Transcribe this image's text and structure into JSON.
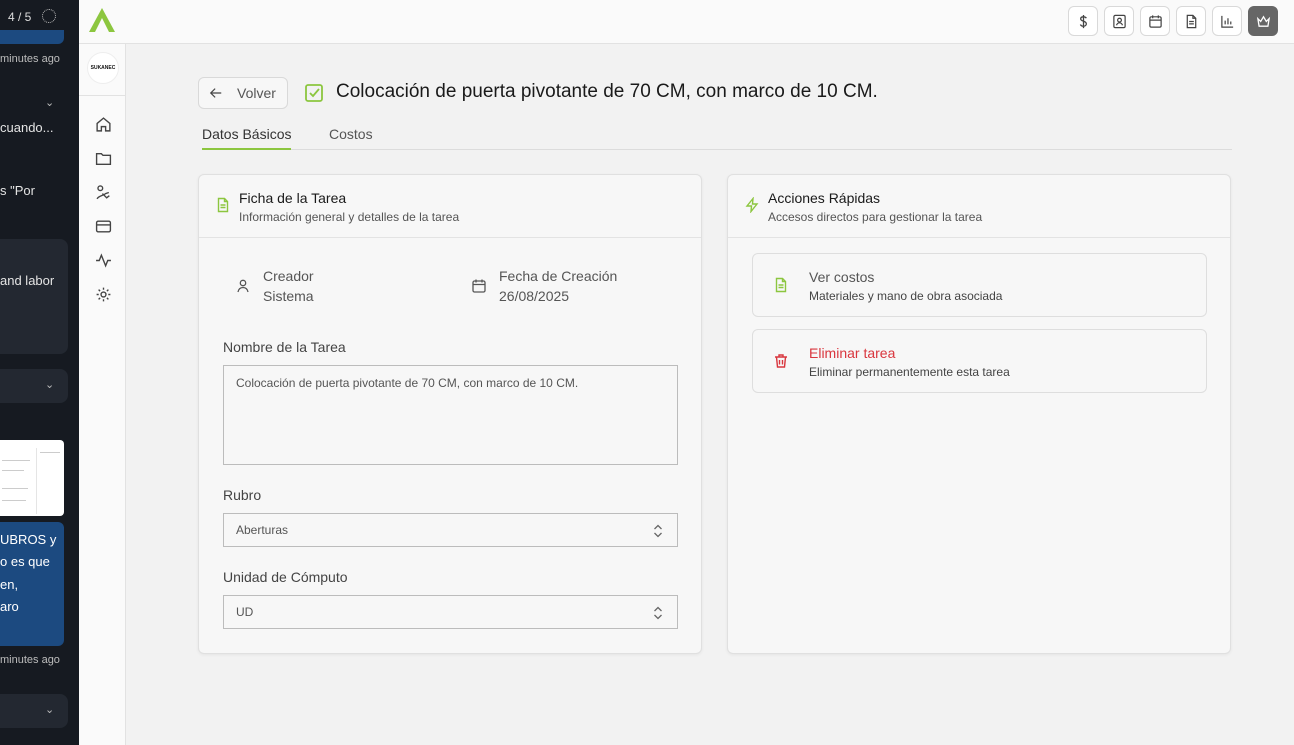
{
  "chat": {
    "counter": "4 / 5",
    "meta_top": "minutes ago",
    "line1": "cuando...",
    "line2": "s \"Por",
    "line3": "and labor",
    "blue_lines": [
      "UBROS y",
      "o es que",
      "en,",
      "aro"
    ],
    "meta_bottom": "minutes ago"
  },
  "topbar": {
    "actions": [
      {
        "icon": "dollar-icon",
        "active": false
      },
      {
        "icon": "contact-card-icon",
        "active": false
      },
      {
        "icon": "calendar-icon",
        "active": false
      },
      {
        "icon": "document-icon",
        "active": false
      },
      {
        "icon": "bar-chart-icon",
        "active": false
      },
      {
        "icon": "crown-icon",
        "active": true
      }
    ]
  },
  "sidebar": {
    "org_logo_text": "SUKANEC",
    "items": [
      "home-icon",
      "folder-icon",
      "tools-icon",
      "credit-card-icon",
      "activity-icon",
      "settings-icon"
    ]
  },
  "header": {
    "back_label": "Volver",
    "title": "Colocación de puerta pivotante de 70 CM, con marco de 10 CM."
  },
  "tabs": [
    {
      "label": "Datos Básicos",
      "active": true
    },
    {
      "label": "Costos",
      "active": false
    }
  ],
  "task_card": {
    "title": "Ficha de la Tarea",
    "subtitle": "Información general y detalles de la tarea",
    "creator_label": "Creador",
    "creator_value": "Sistema",
    "created_label": "Fecha de Creación",
    "created_value": "26/08/2025",
    "name_label": "Nombre de la Tarea",
    "name_value": "Colocación de puerta pivotante de 70 CM, con marco de 10 CM.",
    "rubro_label": "Rubro",
    "rubro_value": "Aberturas",
    "unit_label": "Unidad de Cómputo",
    "unit_value": "UD"
  },
  "quick_actions": {
    "title": "Acciones Rápidas",
    "subtitle": "Accesos directos para gestionar la tarea",
    "items": [
      {
        "title": "Ver costos",
        "subtitle": "Materiales y mano de obra asociada",
        "icon": "document-icon"
      },
      {
        "title": "Eliminar tarea",
        "subtitle": "Eliminar permanentemente esta tarea",
        "icon": "trash-icon"
      }
    ]
  },
  "colors": {
    "accent": "#8cc63f",
    "danger": "#d9363e",
    "chat_blue": "#1c4a80"
  }
}
